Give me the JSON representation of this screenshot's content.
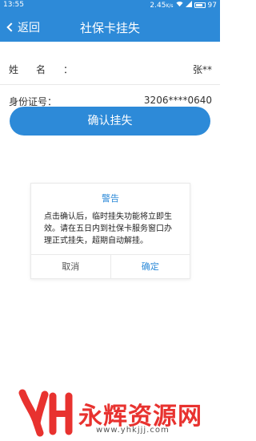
{
  "status_bar": {
    "time": "13:55",
    "speed": "2.45",
    "speed_unit": "K/s",
    "battery": "97"
  },
  "app_bar": {
    "back_label": "返回",
    "title": "社保卡挂失"
  },
  "info": {
    "name_label": "姓名：",
    "name_value": "张**",
    "id_label": "身份证号：",
    "id_value": "3206****0640"
  },
  "confirm_button_label": "确认挂失",
  "dialog": {
    "title": "警告",
    "message": "点击确认后，临时挂失功能将立即生效。请在五日内到社保卡服务窗口办理正式挂失，超期自动解挂。",
    "cancel_label": "取消",
    "ok_label": "确定"
  },
  "watermark": {
    "text": "永辉资源网",
    "url": "www.yhkjjj.com"
  },
  "colors": {
    "primary": "#2d8ad8",
    "watermark_red": "#e8322f"
  }
}
